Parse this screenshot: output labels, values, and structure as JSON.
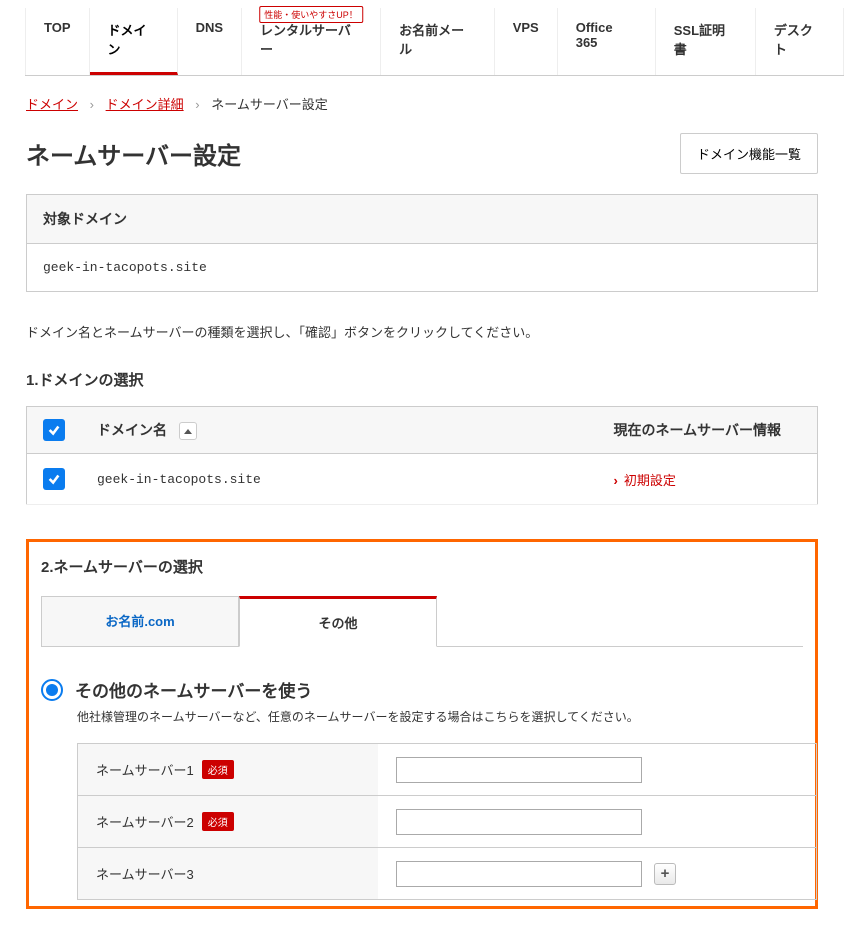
{
  "nav": {
    "tabs": [
      "TOP",
      "ドメイン",
      "DNS",
      "レンタルサーバー",
      "お名前メール",
      "VPS",
      "Office 365",
      "SSL証明書",
      "デスクト"
    ],
    "badge": "性能・使いやすさUP！"
  },
  "breadcrumb": {
    "domain": "ドメイン",
    "detail": "ドメイン詳細",
    "current": "ネームサーバー設定"
  },
  "page_title": "ネームサーバー設定",
  "btn_domain_list": "ドメイン機能一覧",
  "target_domain_header": "対象ドメイン",
  "target_domain_value": "geek-in-tacopots.site",
  "instruction": "ドメイン名とネームサーバーの種類を選択し、「確認」ボタンをクリックしてください。",
  "section1_title": "1.ドメインの選択",
  "domain_table": {
    "col1": "ドメイン名",
    "col2": "現在のネームサーバー情報",
    "row_domain": "geek-in-tacopots.site",
    "row_ns": "初期設定"
  },
  "section2_title": "2.ネームサーバーの選択",
  "ns_tabs": {
    "tab1": "お名前.com",
    "tab2": "その他"
  },
  "radio_label": "その他のネームサーバーを使う",
  "radio_desc": "他社様管理のネームサーバーなど、任意のネームサーバーを設定する場合はこちらを選択してください。",
  "ns_form": {
    "label1": "ネームサーバー1",
    "label2": "ネームサーバー2",
    "label3": "ネームサーバー3",
    "required": "必須",
    "val1": "",
    "val2": "",
    "val3": ""
  }
}
